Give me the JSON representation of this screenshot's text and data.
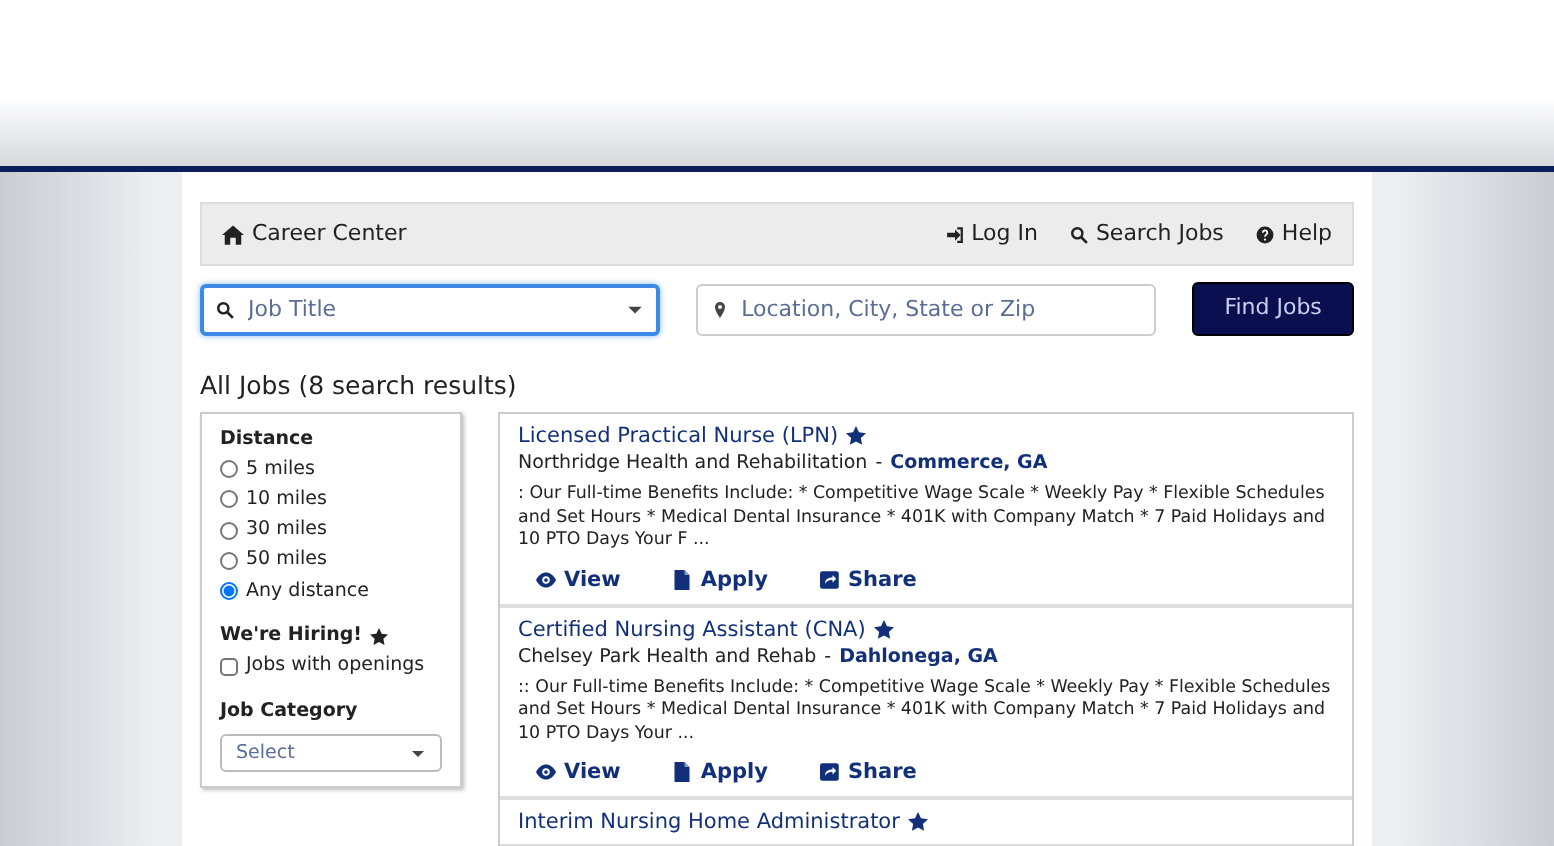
{
  "navbar": {
    "brand": "Career Center",
    "links": [
      {
        "kind": "login",
        "label": "Log In"
      },
      {
        "kind": "search",
        "label": "Search Jobs"
      },
      {
        "kind": "help",
        "label": "Help"
      }
    ]
  },
  "search": {
    "title_placeholder": "Job Title",
    "location_placeholder": "Location, City, State or Zip",
    "button": "Find Jobs"
  },
  "results_heading": "All Jobs (8 search results)",
  "filters": {
    "distance_label": "Distance",
    "distances": [
      {
        "label": "5 miles",
        "selected": false
      },
      {
        "label": "10 miles",
        "selected": false
      },
      {
        "label": "30 miles",
        "selected": false
      },
      {
        "label": "50 miles",
        "selected": false
      },
      {
        "label": "Any distance",
        "selected": true
      }
    ],
    "hiring_label": "We're Hiring!",
    "hiring_option": {
      "label": "Jobs with openings",
      "checked": false
    },
    "category_label": "Job Category",
    "category_placeholder": "Select"
  },
  "jobs": [
    {
      "title": "Licensed Practical Nurse (LPN)",
      "company": "Northridge Health and Rehabilitation",
      "separator": "-",
      "location": "Commerce, GA",
      "summary": ": Our Full-time Benefits Include: * Competitive Wage Scale * Weekly Pay * Flexible Schedules and Set Hours * Medical Dental Insurance * 401K with Company Match * 7 Paid Holidays and 10 PTO Days Your F ...",
      "actions": [
        "View",
        "Apply",
        "Share"
      ]
    },
    {
      "title": "Certified Nursing Assistant (CNA)",
      "company": "Chelsey Park Health and Rehab",
      "separator": "-",
      "location": "Dahlonega, GA",
      "summary": ":: Our Full-time Benefits Include: * Competitive Wage Scale * Weekly Pay * Flexible Schedules and Set Hours * Medical Dental Insurance * 401K with Company Match * 7 Paid Holidays and 10 PTO Days Your ...",
      "actions": [
        "View",
        "Apply",
        "Share"
      ]
    },
    {
      "title": "Interim Nursing Home Administrator"
    }
  ]
}
